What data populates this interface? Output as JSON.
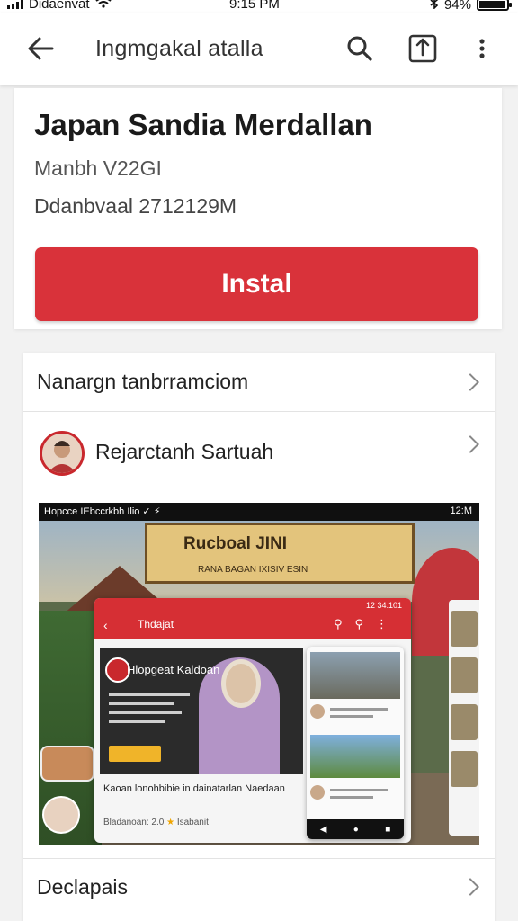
{
  "status_bar": {
    "carrier": "Didaenvat",
    "time": "9:15 PM",
    "battery": "94%",
    "battery_level": 0.94
  },
  "app_bar": {
    "title": "Ingmgakal atalla"
  },
  "app_info": {
    "name": "Japan Sandia Merdallan",
    "developer_line": "Manbh V22GI",
    "size_line": "Ddanbvaal 2712129M",
    "install_label": "Instal",
    "accent_color": "#d9323a"
  },
  "details": {
    "about_label": "Nanargn tanbrramciom",
    "developer_label": "Rejarctanh Sartuah",
    "bottom_label": "Declapais"
  },
  "screenshot": {
    "status_left": "Hopcce IEbccrkbh  Ilio  ✓  ⚡",
    "status_right": "12:M",
    "sign_title": "Rucboal JINI",
    "sign_subtitle": "RANA BAGAN  IXISIV ESIN",
    "phone_title": "Thdajat",
    "phone_status": "12 34:101",
    "main_label": "Hlopgeat Kaldoan",
    "caption": "Kaoan lonohbibie in dainatarlan Naedaan",
    "rating_prefix": "Bladanoan:",
    "rating_value": "2.0",
    "rating_suffix": "Isabanit"
  }
}
